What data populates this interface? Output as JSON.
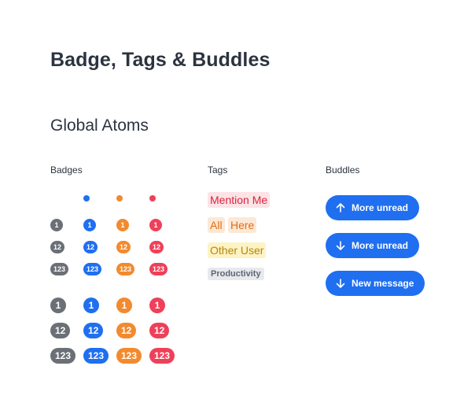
{
  "title": "Badge, Tags & Buddles",
  "section": "Global Atoms",
  "columns": {
    "badges": "Badges",
    "tags": "Tags",
    "buddles": "Buddles"
  },
  "colors": {
    "gray": "#6b6f76",
    "blue": "#1f6ff0",
    "orange": "#f28a2e",
    "red": "#ef4059"
  },
  "badges": {
    "small": [
      "1",
      "12",
      "123"
    ],
    "large": [
      "1",
      "12",
      "123"
    ]
  },
  "tags": {
    "mention_me": "Mention Me",
    "all": "All",
    "here": "Here",
    "other_user": "Other User",
    "productivity": "Productivity"
  },
  "buddles": [
    {
      "label": "More unread",
      "icon": "arrow-up-icon"
    },
    {
      "label": "More unread",
      "icon": "arrow-down-icon"
    },
    {
      "label": "New message",
      "icon": "arrow-down-icon"
    }
  ]
}
